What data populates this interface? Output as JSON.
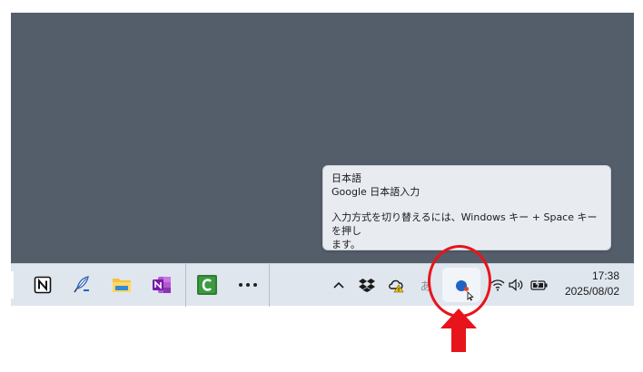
{
  "tooltip": {
    "title": "日本語",
    "subtitle": "Google 日本語入力",
    "message_line1": "入力方式を切り替えるには、Windows キー + Space キーを押し",
    "message_line2": "ます。"
  },
  "taskbar": {
    "apps": [
      {
        "name": "notion",
        "icon": "notion-icon"
      },
      {
        "name": "quill",
        "icon": "quill-icon"
      },
      {
        "name": "file-explorer",
        "icon": "folder-icon"
      },
      {
        "name": "onenote",
        "icon": "onenote-icon"
      },
      {
        "name": "camtasia",
        "icon": "camtasia-icon"
      },
      {
        "name": "more",
        "icon": "more-dots-icon"
      }
    ],
    "tray": [
      "chevron-up-icon",
      "dropbox-icon",
      "onedrive-warning-icon",
      "ime-mode-icon",
      "google-ime-icon",
      "wifi-icon",
      "volume-icon",
      "battery-icon"
    ],
    "ime_mode_glyph": "あ"
  },
  "clock": {
    "time": "17:38",
    "date": "2025/08/02"
  },
  "colors": {
    "desktop": "#545e6a",
    "taskbar": "#dfe6ee",
    "highlight": "#e8141b",
    "ime_blue": "#1f63c8"
  }
}
